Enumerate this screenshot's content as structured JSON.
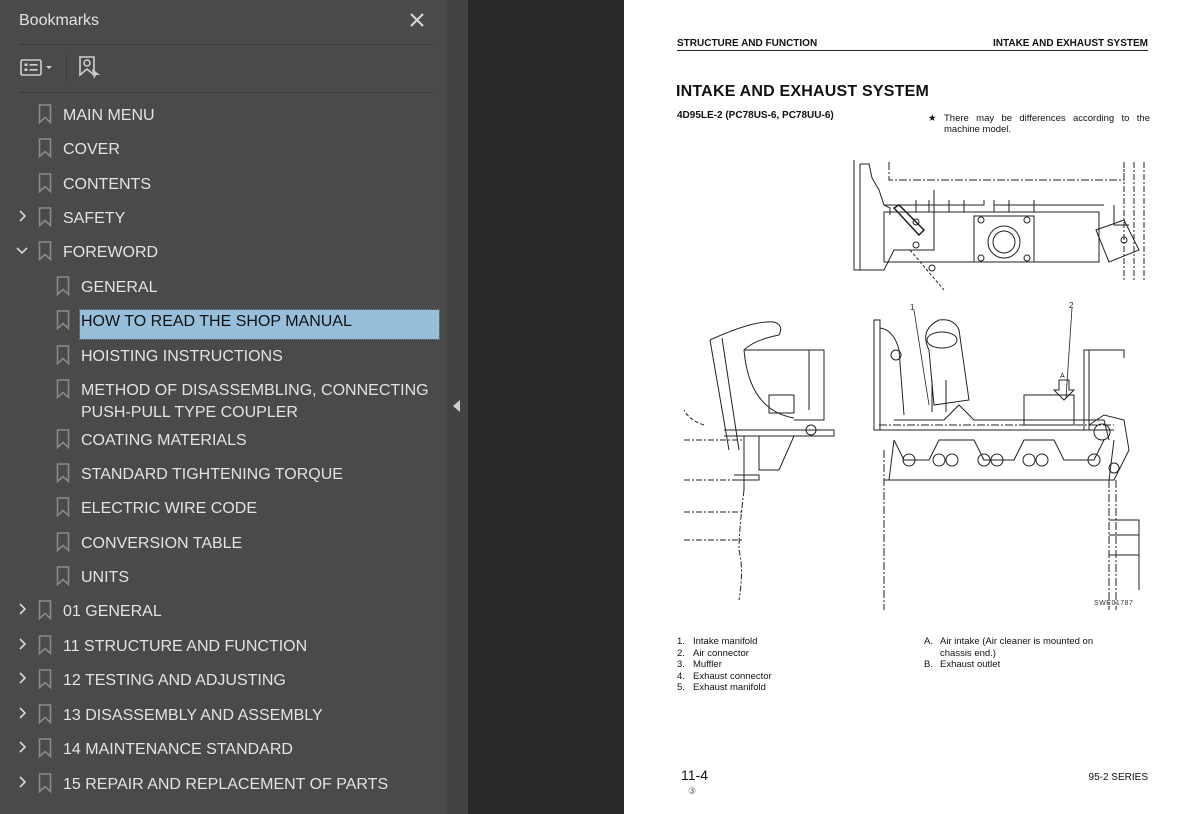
{
  "bookmarks_panel": {
    "title": "Bookmarks",
    "close_icon": "close-icon",
    "toolbar": {
      "options_icon": "list-options-icon",
      "find_icon": "find-current-bookmark-icon"
    },
    "items": [
      {
        "label": "MAIN MENU",
        "level": 0,
        "expander": "none"
      },
      {
        "label": "COVER",
        "level": 0,
        "expander": "none"
      },
      {
        "label": "CONTENTS",
        "level": 0,
        "expander": "none"
      },
      {
        "label": "SAFETY",
        "level": 0,
        "expander": "collapsed"
      },
      {
        "label": "FOREWORD",
        "level": 0,
        "expander": "expanded"
      },
      {
        "label": "GENERAL",
        "level": 1,
        "expander": "none"
      },
      {
        "label": "HOW TO READ THE SHOP MANUAL",
        "level": 1,
        "expander": "none",
        "selected": true
      },
      {
        "label": "HOISTING INSTRUCTIONS",
        "level": 1,
        "expander": "none"
      },
      {
        "label": "METHOD OF DISASSEMBLING, CONNECTING",
        "label_line2": "PUSH-PULL TYPE COUPLER",
        "level": 1,
        "expander": "none"
      },
      {
        "label": "COATING MATERIALS",
        "level": 1,
        "expander": "none"
      },
      {
        "label": "STANDARD TIGHTENING TORQUE",
        "level": 1,
        "expander": "none"
      },
      {
        "label": "ELECTRIC WIRE CODE",
        "level": 1,
        "expander": "none"
      },
      {
        "label": "CONVERSION TABLE",
        "level": 1,
        "expander": "none"
      },
      {
        "label": "UNITS",
        "level": 1,
        "expander": "none"
      },
      {
        "label": "01 GENERAL",
        "level": 0,
        "expander": "collapsed"
      },
      {
        "label": "11 STRUCTURE AND FUNCTION",
        "level": 0,
        "expander": "collapsed"
      },
      {
        "label": "12 TESTING AND ADJUSTING",
        "level": 0,
        "expander": "collapsed"
      },
      {
        "label": "13 DISASSEMBLY AND ASSEMBLY",
        "level": 0,
        "expander": "collapsed"
      },
      {
        "label": "14 MAINTENANCE STANDARD",
        "level": 0,
        "expander": "collapsed"
      },
      {
        "label": "15 REPAIR AND REPLACEMENT OF PARTS",
        "level": 0,
        "expander": "collapsed"
      }
    ],
    "selection_color": "#97bfdb"
  },
  "document_page": {
    "running_head_left": "STRUCTURE AND FUNCTION",
    "running_head_right": "INTAKE AND EXHAUST SYSTEM",
    "title": "INTAKE AND EXHAUST SYSTEM",
    "subtitle": "4D95LE-2 (PC78US-6, PC78UU-6)",
    "note_symbol": "★",
    "note": "There may be differences according to the machine model.",
    "figure": {
      "id": "SWE01787",
      "callouts": [
        "1",
        "2",
        "A"
      ]
    },
    "legend_numbered": [
      {
        "num": "1.",
        "text": "Intake manifold"
      },
      {
        "num": "2.",
        "text": "Air connector"
      },
      {
        "num": "3.",
        "text": "Muffler"
      },
      {
        "num": "4.",
        "text": "Exhaust connector"
      },
      {
        "num": "5.",
        "text": "Exhaust manifold"
      }
    ],
    "legend_lettered": [
      {
        "num": "A.",
        "text": "Air intake (Air cleaner is mounted on",
        "text2": "chassis end.)"
      },
      {
        "num": "B.",
        "text": "Exhaust outlet"
      }
    ],
    "page_number": "11-4",
    "revision_mark": "③",
    "series": "95-2 SERIES"
  }
}
